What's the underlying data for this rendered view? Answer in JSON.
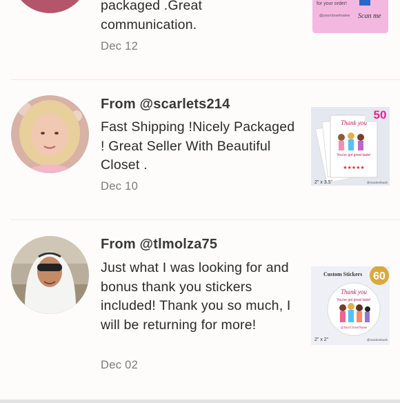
{
  "reviews": [
    {
      "from": "",
      "text": "packaged .Great communication.",
      "date": "Dec 12",
      "thumb_text": {
        "line1": "for your order!",
        "line2": "@yourclosetname",
        "line3": "Scan me"
      }
    },
    {
      "from": "From @scarlets214",
      "text": "Fast Shipping !Nicely Packaged ! Great Seller With Beautiful Closet .",
      "date": "Dec 10",
      "thumb_text": {
        "badge": "50",
        "title": "Thank you",
        "sub": "You've got great taste!",
        "size": "2\" x 3.5\"",
        "brand": "@mackenbuds"
      }
    },
    {
      "from": "From @tlmolza75",
      "text": "Just what I was looking for and bonus thank you stickers included! Thank you so much, I will be returning for more!",
      "date": "Dec 02",
      "thumb_text": {
        "badge": "60",
        "title": "Custom Stickers",
        "sub": "Thank you",
        "sub2": "You've got great taste!",
        "handle": "@YourClosetName",
        "size": "2\" x 2\"",
        "brand": "@mackenbuds"
      }
    }
  ],
  "colors": {
    "badge_pink": "#e8228e",
    "badge_gold": "#d9a93a",
    "divider": "#eeeae4"
  }
}
